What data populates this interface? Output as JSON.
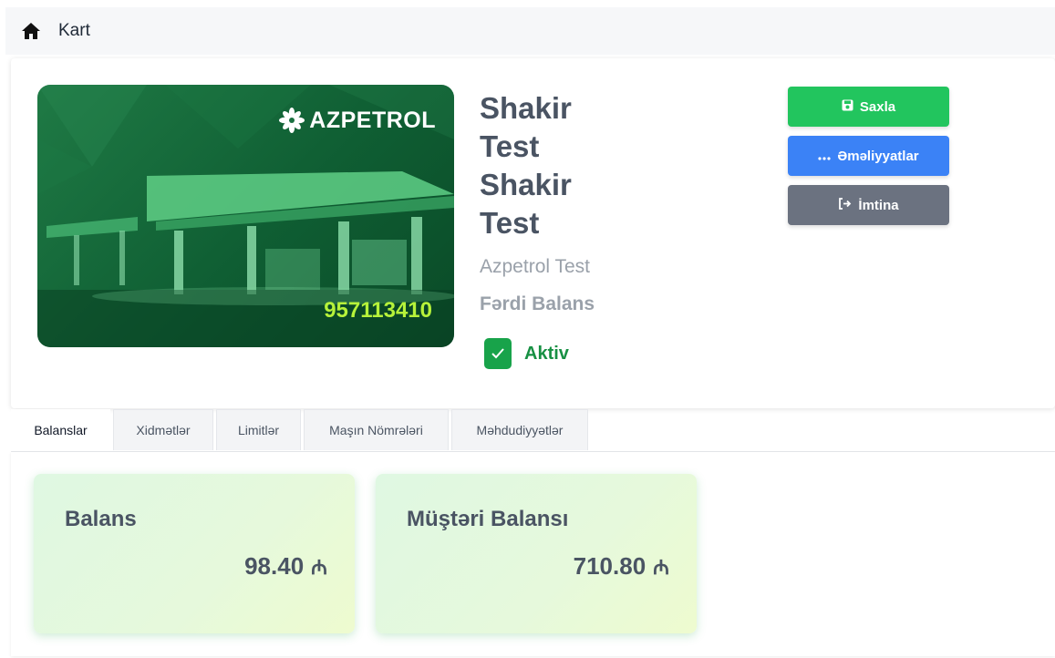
{
  "breadcrumb": {
    "label": "Kart"
  },
  "card": {
    "brand": "AZPETROL",
    "number": "957113410"
  },
  "holder": {
    "name_lines": [
      "Shakir",
      "Test",
      "Shakir",
      "Test"
    ],
    "company": "Azpetrol Test",
    "balance_type": "Fərdi Balans",
    "status": "Aktiv"
  },
  "actions": {
    "save": "Saxla",
    "operations": "Əməliyyatlar",
    "cancel": "İmtina"
  },
  "tabs": [
    {
      "label": "Balanslar",
      "active": true
    },
    {
      "label": "Xidmətlər",
      "active": false
    },
    {
      "label": "Limitlər",
      "active": false
    },
    {
      "label": "Maşın Nömrələri",
      "active": false
    },
    {
      "label": "Məhdudiyyətlər",
      "active": false
    }
  ],
  "balances": [
    {
      "title": "Balans",
      "amount": "98.40",
      "currency": "₼"
    },
    {
      "title": "Müştəri Balansı",
      "amount": "710.80",
      "currency": "₼"
    }
  ],
  "colors": {
    "save": "#22c55e",
    "operations": "#3b82f6",
    "cancel": "#6b7280",
    "status": "#179043",
    "card_number": "#b6f23a"
  },
  "icons": {
    "home": "home-icon",
    "save": "floppy-disk-icon",
    "operations": "ellipsis-icon",
    "cancel": "sign-out-icon",
    "status": "checkmark-icon",
    "brand": "flower-logo-icon"
  }
}
